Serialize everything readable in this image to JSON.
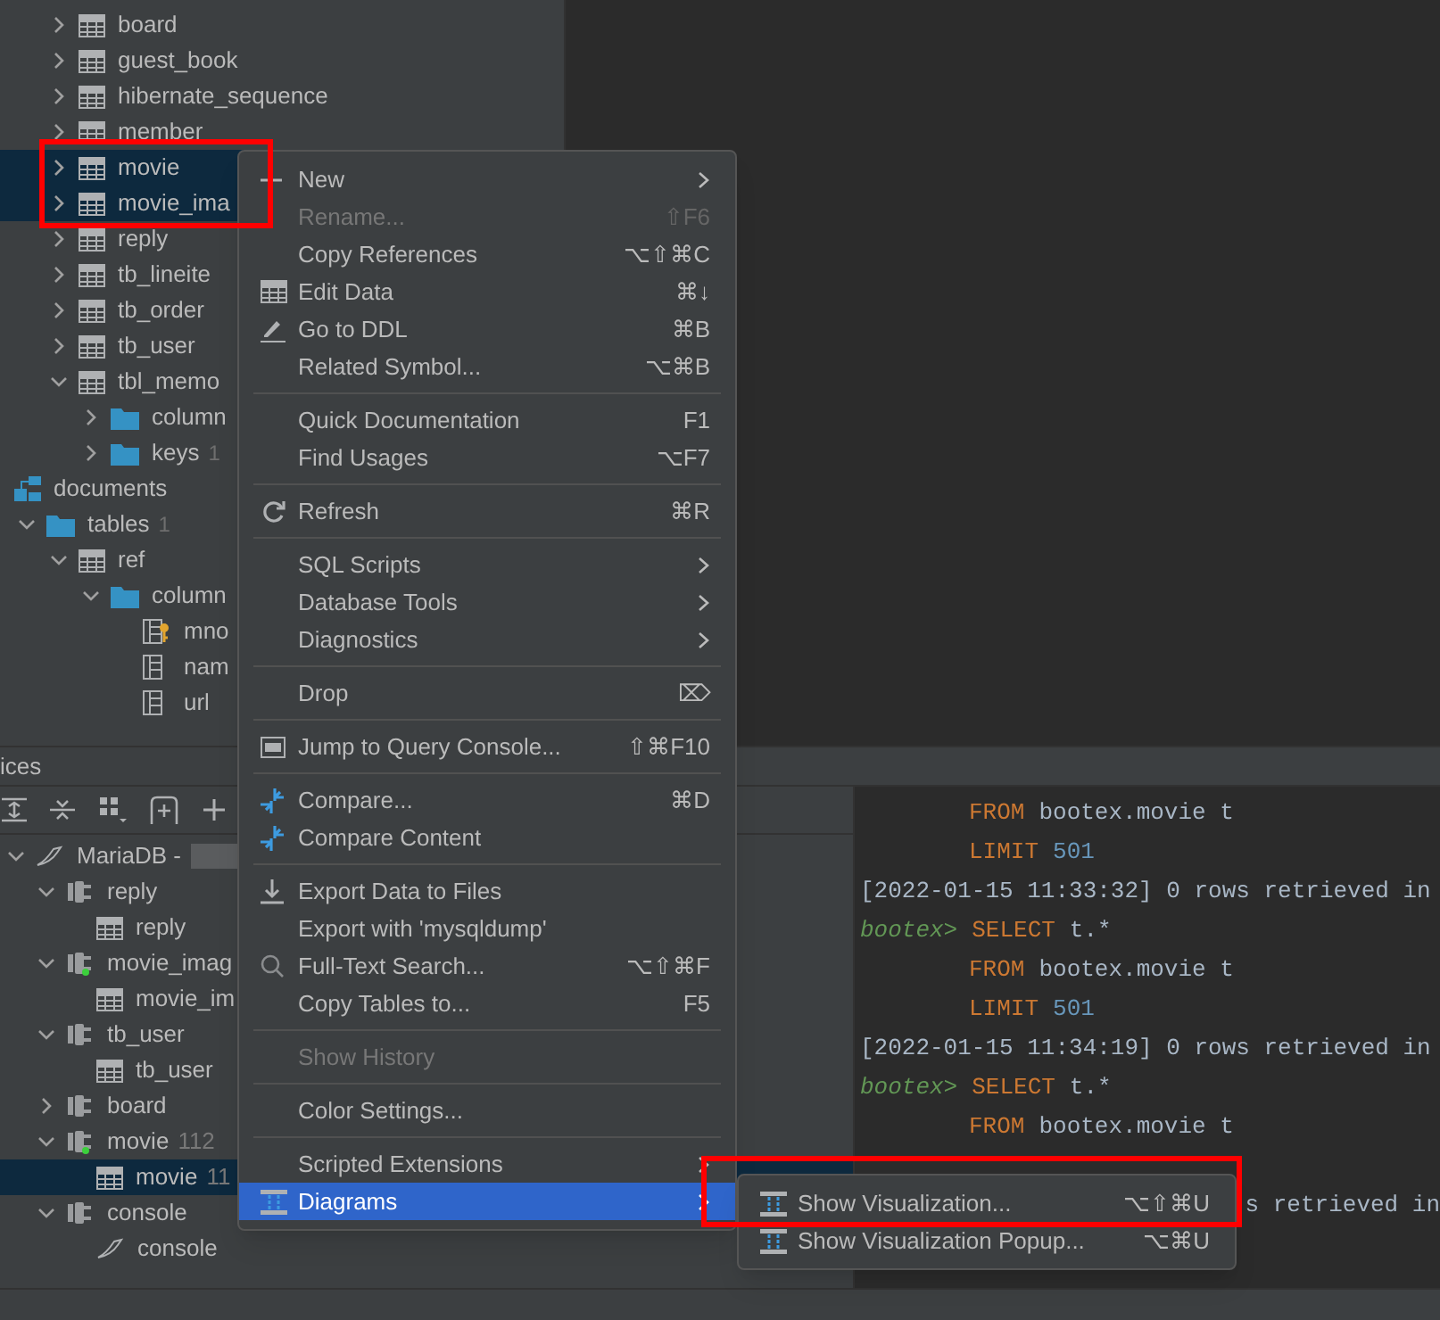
{
  "db_tree": [
    {
      "label": "board",
      "kind": "table",
      "expanded": false,
      "selected": false
    },
    {
      "label": "guest_book",
      "kind": "table",
      "expanded": false,
      "selected": false
    },
    {
      "label": "hibernate_sequence",
      "kind": "table",
      "expanded": false,
      "selected": false
    },
    {
      "label": "member",
      "kind": "table",
      "expanded": false,
      "selected": false
    },
    {
      "label": "movie",
      "kind": "table",
      "expanded": false,
      "selected": true
    },
    {
      "label": "movie_ima",
      "kind": "table",
      "expanded": false,
      "selected": true
    },
    {
      "label": "reply",
      "kind": "table",
      "expanded": false,
      "selected": false
    },
    {
      "label": "tb_lineite",
      "kind": "table",
      "expanded": false,
      "selected": false
    },
    {
      "label": "tb_order",
      "kind": "table",
      "expanded": false,
      "selected": false
    },
    {
      "label": "tb_user",
      "kind": "table",
      "expanded": false,
      "selected": false
    },
    {
      "label": "tbl_memo",
      "kind": "table",
      "expanded": true,
      "selected": false,
      "children": [
        {
          "label": "column",
          "kind": "folder",
          "expanded": false,
          "selected": false
        },
        {
          "label": "keys",
          "count": "1",
          "kind": "folder",
          "expanded": false,
          "selected": false
        }
      ]
    }
  ],
  "schemas": [
    {
      "label": "documents",
      "kind": "schema",
      "selected": false,
      "children": [
        {
          "label": "tables",
          "count": "1",
          "kind": "folder",
          "expanded": true,
          "selected": false,
          "children": [
            {
              "label": "ref",
              "kind": "table",
              "expanded": true,
              "selected": false,
              "children": [
                {
                  "label": "column",
                  "kind": "folder",
                  "expanded": true,
                  "selected": false,
                  "children": [
                    {
                      "label": "mno",
                      "kind": "key_column",
                      "selected": false
                    },
                    {
                      "label": "nam",
                      "kind": "column",
                      "selected": false
                    },
                    {
                      "label": "url",
                      "kind": "column",
                      "selected": false
                    }
                  ]
                }
              ]
            }
          ]
        }
      ]
    }
  ],
  "context_menu": {
    "groups": [
      [
        {
          "label": "New",
          "submenu": true,
          "disabled": false,
          "selected": false
        },
        {
          "label": "Rename...",
          "shortcut": "⇧F6",
          "submenu": false,
          "disabled": true,
          "selected": false
        },
        {
          "label": "Copy References",
          "shortcut": "⌥⇧⌘C",
          "submenu": false,
          "disabled": false,
          "selected": false
        },
        {
          "label": "Edit Data",
          "shortcut": "⌘↓",
          "submenu": false,
          "disabled": false,
          "selected": false
        },
        {
          "label": "Go to DDL",
          "shortcut": "⌘B",
          "submenu": false,
          "disabled": false,
          "selected": false
        },
        {
          "label": "Related Symbol...",
          "shortcut": "⌥⌘B",
          "submenu": false,
          "disabled": false,
          "selected": false
        }
      ],
      [
        {
          "label": "Quick Documentation",
          "shortcut": "F1",
          "submenu": false,
          "disabled": false,
          "selected": false
        },
        {
          "label": "Find Usages",
          "shortcut": "⌥F7",
          "submenu": false,
          "disabled": false,
          "selected": false
        }
      ],
      [
        {
          "label": "Refresh",
          "shortcut": "⌘R",
          "submenu": false,
          "disabled": false,
          "selected": false
        }
      ],
      [
        {
          "label": "SQL Scripts",
          "submenu": true,
          "disabled": false,
          "selected": false
        },
        {
          "label": "Database Tools",
          "submenu": true,
          "disabled": false,
          "selected": false
        },
        {
          "label": "Diagnostics",
          "submenu": true,
          "disabled": false,
          "selected": false
        }
      ],
      [
        {
          "label": "Drop",
          "shortcut": "⌦",
          "submenu": false,
          "disabled": false,
          "selected": false
        }
      ],
      [
        {
          "label": "Jump to Query Console...",
          "shortcut": "⇧⌘F10",
          "submenu": false,
          "disabled": false,
          "selected": false
        }
      ],
      [
        {
          "label": "Compare...",
          "shortcut": "⌘D",
          "submenu": false,
          "disabled": false,
          "selected": false
        },
        {
          "label": "Compare Content",
          "submenu": false,
          "disabled": false,
          "selected": false
        }
      ],
      [
        {
          "label": "Export Data to Files",
          "submenu": false,
          "disabled": false,
          "selected": false
        },
        {
          "label": "Export with 'mysqldump'",
          "submenu": false,
          "disabled": false,
          "selected": false
        },
        {
          "label": "Full-Text Search...",
          "shortcut": "⌥⇧⌘F",
          "submenu": false,
          "disabled": false,
          "selected": false
        },
        {
          "label": "Copy Tables to...",
          "shortcut": "F5",
          "submenu": false,
          "disabled": false,
          "selected": false
        }
      ],
      [
        {
          "label": "Show History",
          "submenu": false,
          "disabled": true,
          "selected": false
        }
      ],
      [
        {
          "label": "Color Settings...",
          "submenu": false,
          "disabled": false,
          "selected": false
        }
      ],
      [
        {
          "label": "Scripted Extensions",
          "submenu": true,
          "disabled": false,
          "selected": false
        },
        {
          "label": "Diagrams",
          "submenu": true,
          "disabled": false,
          "selected": true
        }
      ]
    ]
  },
  "submenu": [
    {
      "label": "Show Visualization...",
      "shortcut": "⌥⇧⌘U"
    },
    {
      "label": "Show Visualization Popup...",
      "shortcut": "⌥⌘U"
    }
  ],
  "services": {
    "title": "ices",
    "tree": [
      {
        "label": "MariaDB -",
        "kind": "datasource",
        "expanded": true,
        "selected": false,
        "children": [
          {
            "label": "reply",
            "kind": "session",
            "running": false,
            "expanded": true,
            "selected": false,
            "children": [
              {
                "label": "reply",
                "kind": "table",
                "selected": false
              }
            ]
          },
          {
            "label": "movie_imag",
            "kind": "session",
            "running": true,
            "expanded": true,
            "selected": false,
            "children": [
              {
                "label": "movie_im",
                "kind": "table",
                "selected": false
              }
            ]
          },
          {
            "label": "tb_user",
            "kind": "session",
            "running": false,
            "expanded": true,
            "selected": false,
            "children": [
              {
                "label": "tb_user",
                "kind": "table",
                "selected": false
              }
            ]
          },
          {
            "label": "board",
            "kind": "session",
            "running": false,
            "expanded": false,
            "selected": false
          },
          {
            "label": "movie",
            "detail": "112",
            "kind": "session",
            "running": true,
            "expanded": true,
            "selected": false,
            "children": [
              {
                "label": "movie",
                "detail": "11",
                "kind": "table",
                "selected": true
              }
            ]
          },
          {
            "label": "console",
            "kind": "session",
            "running": false,
            "expanded": true,
            "selected": false,
            "children": [
              {
                "label": "console",
                "kind": "console",
                "selected": false
              }
            ]
          }
        ]
      }
    ]
  },
  "console": [
    {
      "kind": "indent",
      "tokens": [
        {
          "kind": "keyword",
          "text": "FROM"
        },
        {
          "kind": "plain",
          "text": "bootex.movie t"
        }
      ]
    },
    {
      "kind": "indent",
      "tokens": [
        {
          "kind": "keyword",
          "text": "LIMIT"
        },
        {
          "kind": "number",
          "text": "501"
        }
      ]
    },
    {
      "kind": "log",
      "tokens": [
        {
          "kind": "plain",
          "text": "[2022-01-15 11:33:32] 0 rows retrieved in"
        }
      ]
    },
    {
      "kind": "prompt",
      "tokens": [
        {
          "kind": "prompt",
          "text": "bootex>"
        },
        {
          "kind": "keyword",
          "text": "SELECT"
        },
        {
          "kind": "plain",
          "text": "t.*"
        }
      ]
    },
    {
      "kind": "indent",
      "tokens": [
        {
          "kind": "keyword",
          "text": "FROM"
        },
        {
          "kind": "plain",
          "text": "bootex.movie t"
        }
      ]
    },
    {
      "kind": "indent",
      "tokens": [
        {
          "kind": "keyword",
          "text": "LIMIT"
        },
        {
          "kind": "number",
          "text": "501"
        }
      ]
    },
    {
      "kind": "log",
      "tokens": [
        {
          "kind": "plain",
          "text": "[2022-01-15 11:34:19] 0 rows retrieved in"
        }
      ]
    },
    {
      "kind": "prompt",
      "tokens": [
        {
          "kind": "prompt",
          "text": "bootex>"
        },
        {
          "kind": "keyword",
          "text": "SELECT"
        },
        {
          "kind": "plain",
          "text": "t.*"
        }
      ]
    },
    {
      "kind": "indent",
      "tokens": [
        {
          "kind": "keyword",
          "text": "FROM"
        },
        {
          "kind": "plain",
          "text": "bootex.movie t"
        }
      ]
    },
    {
      "kind": "blank"
    },
    {
      "kind": "tail",
      "tokens": [
        {
          "kind": "plain",
          "text": "s retrieved in"
        }
      ]
    }
  ]
}
